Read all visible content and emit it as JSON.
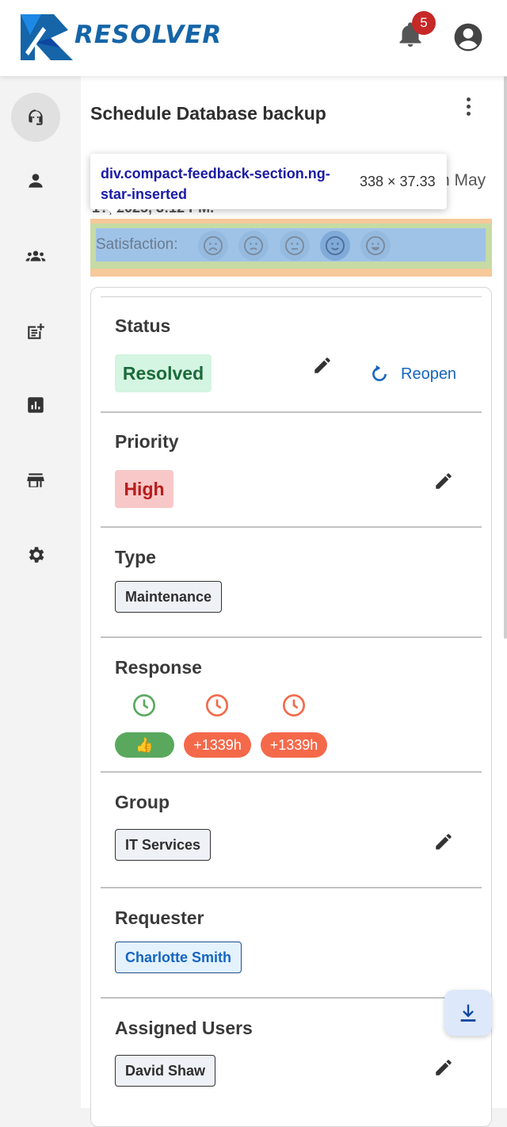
{
  "app": {
    "logo_text": "RESOLVER"
  },
  "header": {
    "notification_count": "5"
  },
  "nav": {
    "items": [
      {
        "name": "support-agent-icon",
        "active": true
      },
      {
        "name": "person-icon",
        "active": false
      },
      {
        "name": "groups-icon",
        "active": false
      },
      {
        "name": "post-add-icon",
        "active": false
      },
      {
        "name": "analytics-icon",
        "active": false
      },
      {
        "name": "store-icon",
        "active": false
      },
      {
        "name": "settings-icon",
        "active": false
      }
    ]
  },
  "ticket": {
    "title": "Schedule Database backup",
    "meta_partial_right": "n May",
    "meta_partial_line2": "1?, 2025, 3:12 PM."
  },
  "devtools_tooltip": {
    "selector_tag": "div",
    "selector_class": ".compact-feedback-section.ng-star-inserted",
    "size": "338 × 37.33"
  },
  "satisfaction": {
    "label": "Satisfaction:",
    "selected_index": 3,
    "faces": [
      "very-dissatisfied-icon",
      "dissatisfied-icon",
      "neutral-icon",
      "satisfied-icon",
      "very-satisfied-icon"
    ]
  },
  "status": {
    "title": "Status",
    "value": "Resolved",
    "reopen_label": "Reopen"
  },
  "priority": {
    "title": "Priority",
    "value": "High"
  },
  "type": {
    "title": "Type",
    "value": "Maintenance"
  },
  "response": {
    "title": "Response",
    "pills": [
      {
        "label": "👍",
        "color": "#5aa85e"
      },
      {
        "label": "+1339h",
        "color": "#f4694a"
      },
      {
        "label": "+1339h",
        "color": "#f4694a"
      }
    ],
    "clock_colors": [
      "#5aa85e",
      "#f4694a",
      "#f4694a"
    ]
  },
  "group": {
    "title": "Group",
    "value": "IT Services"
  },
  "requester": {
    "title": "Requester",
    "value": "Charlotte Smith"
  },
  "assigned": {
    "title": "Assigned Users",
    "value": "David Shaw"
  },
  "colors": {
    "brand": "#1565a8",
    "accent": "#1565c0",
    "resolved_bg": "#d4f5e2",
    "high_bg": "#f8c8c8"
  }
}
